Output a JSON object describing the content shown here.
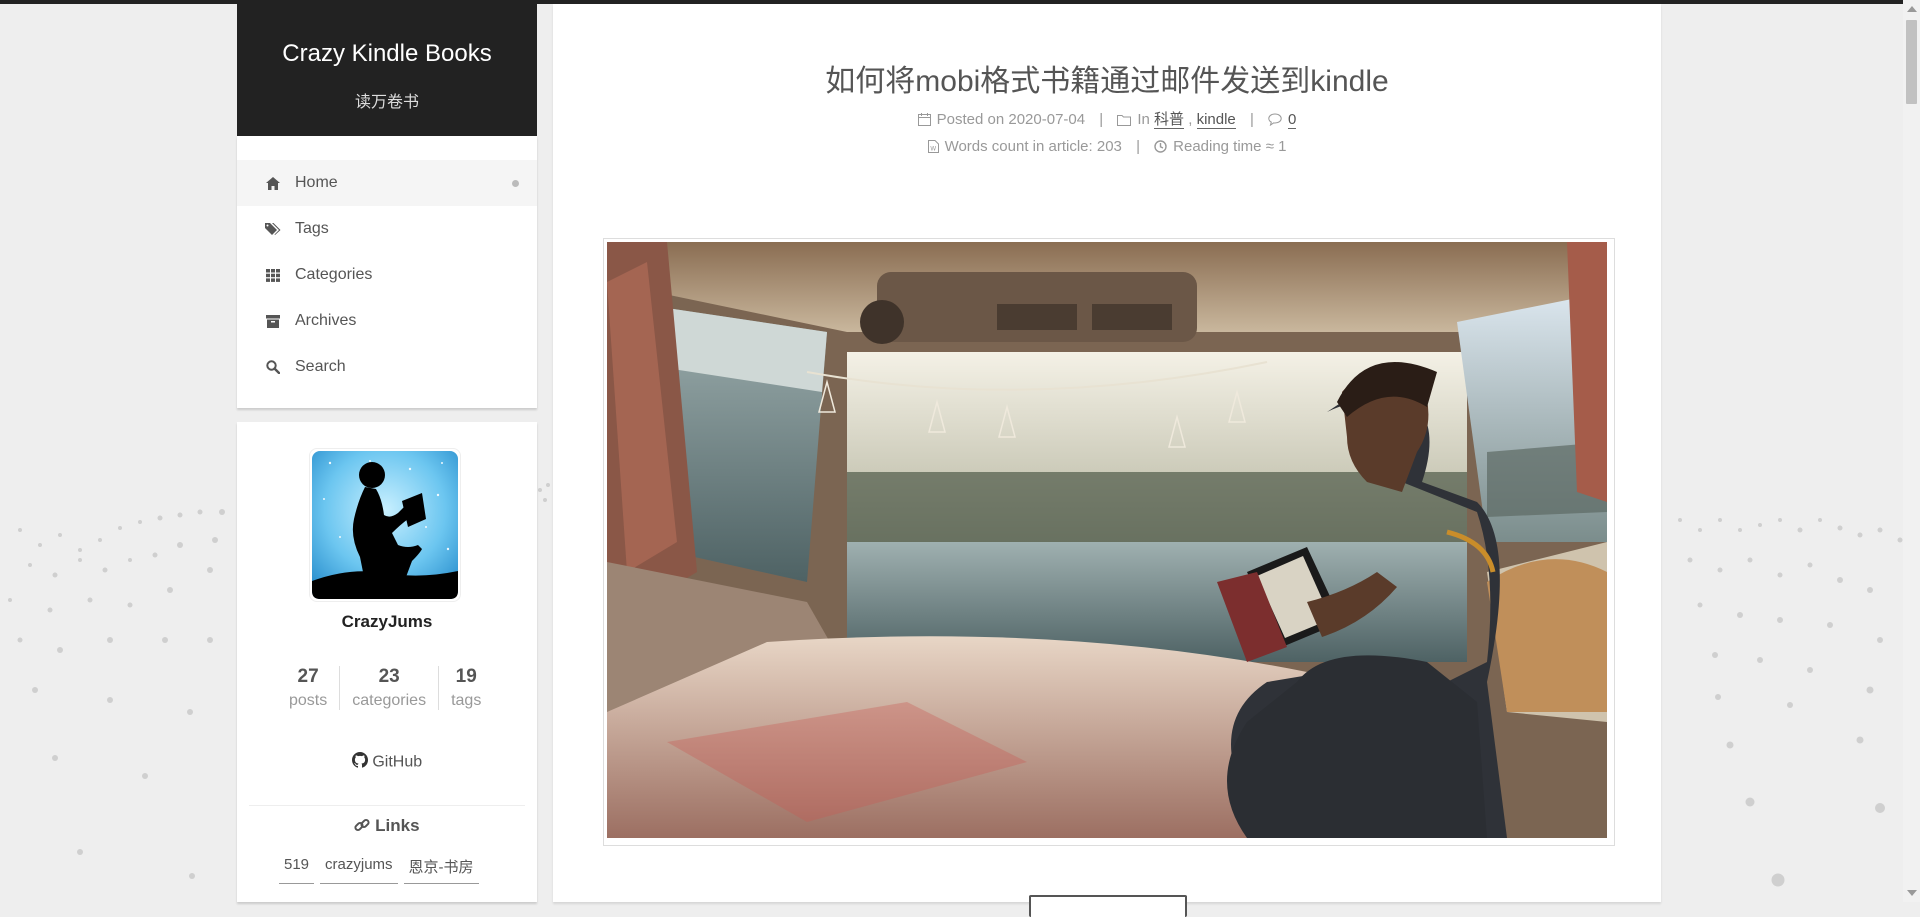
{
  "site": {
    "title": "Crazy Kindle Books",
    "subtitle": "读万卷书"
  },
  "menu": [
    {
      "label": "Home",
      "icon": "home-icon",
      "active": true
    },
    {
      "label": "Tags",
      "icon": "tags-icon"
    },
    {
      "label": "Categories",
      "icon": "grid-icon"
    },
    {
      "label": "Archives",
      "icon": "archive-icon"
    },
    {
      "label": "Search",
      "icon": "search-icon"
    }
  ],
  "profile": {
    "name": "CrazyJums",
    "stats": [
      {
        "value": "27",
        "label": "posts"
      },
      {
        "value": "23",
        "label": "categories"
      },
      {
        "value": "19",
        "label": "tags"
      }
    ],
    "github_label": "GitHub",
    "links_title": "Links",
    "links": [
      "519",
      "crazyjums",
      "恩京-书房"
    ]
  },
  "post": {
    "title": "如何将mobi格式书籍通过邮件发送到kindle",
    "posted_label": "Posted on",
    "date": "2020-07-04",
    "in_label": "In",
    "categories": [
      "科普",
      "kindle"
    ],
    "comments": "0",
    "words_label": "Words count in article:",
    "words": "203",
    "reading_label": "Reading time ≈",
    "reading": "1",
    "image_icon": "man-reading-kindle-in-van-photo"
  },
  "colors": {
    "header_bg": "#222222",
    "page_bg": "#eeeeee",
    "card_bg": "#ffffff",
    "text": "#555555",
    "muted": "#999999"
  }
}
